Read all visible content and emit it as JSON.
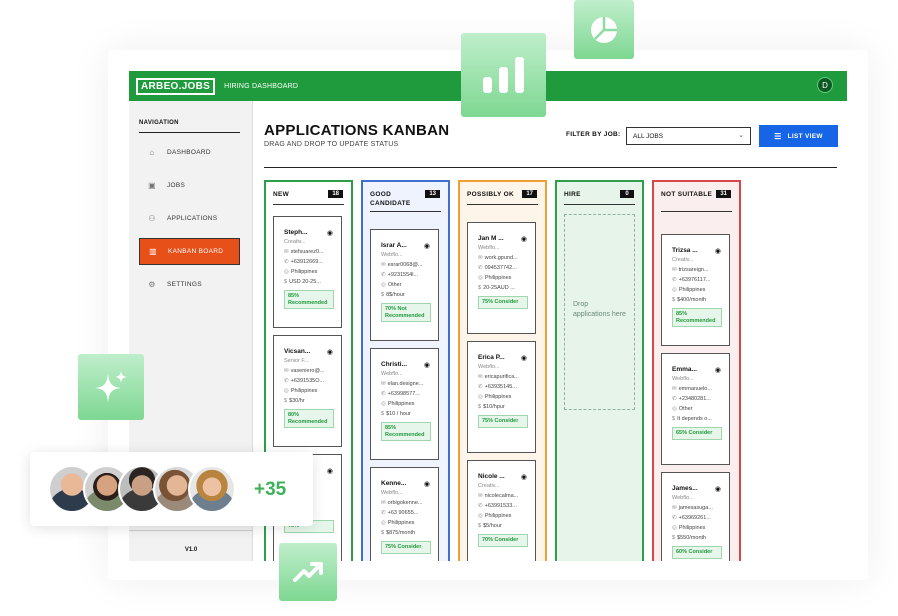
{
  "app": {
    "logo": "ARBEO.JOBS",
    "header": "HIRING DASHBOARD",
    "avatar": "D"
  },
  "sidebar": {
    "title": "NAVIGATION",
    "version": "V1.0",
    "items": [
      {
        "label": "DASHBOARD",
        "icon": "home-icon"
      },
      {
        "label": "JOBS",
        "icon": "briefcase-icon"
      },
      {
        "label": "APPLICATIONS",
        "icon": "users-icon"
      },
      {
        "label": "KANBAN BOARD",
        "icon": "kanban-icon",
        "active": true
      },
      {
        "label": "SETTINGS",
        "icon": "gear-icon"
      }
    ]
  },
  "main": {
    "title": "APPLICATIONS KANBAN",
    "subtitle": "DRAG AND DROP TO UPDATE STATUS",
    "filter_label": "FILTER BY JOB:",
    "filter_value": "ALL JOBS",
    "list_view": "LIST VIEW"
  },
  "columns": [
    {
      "name": "NEW",
      "count": "18",
      "color": "#2e9e4a",
      "bg": "#fff",
      "cards": [
        {
          "name": "Steph...",
          "role": "Creativ...",
          "email": "stefsuarez0...",
          "phone": "+63912669...",
          "loc": "Philippines",
          "rate": "USD 20-25...",
          "badge": "85% Recommended"
        },
        {
          "name": "Vicsan...",
          "role": "Senior F...",
          "email": "vasenierо@...",
          "phone": "+6391535О...",
          "loc": "Philippines",
          "rate": "$30/hr",
          "badge": "80% Recommended"
        },
        {
          "name": "",
          "role": "",
          "email": "...gro...",
          "phone": "...57...",
          "loc": "...nes",
          "rate": "...rs $...",
          "badge": "75%"
        }
      ]
    },
    {
      "name": "GOOD CANDIDATE",
      "count": "13",
      "color": "#3f6fd1",
      "bg": "#eef3fd",
      "cards": [
        {
          "name": "Israr A...",
          "role": "Webflo...",
          "email": "esrar0068@...",
          "phone": "+9231554l...",
          "loc": "Other",
          "rate": "8$/hour",
          "badge": "70% Not Recommended"
        },
        {
          "name": "Christi...",
          "role": "Webflo...",
          "email": "elan.designe...",
          "phone": "+63998577...",
          "loc": "Philippines",
          "rate": "$10 / hour",
          "badge": "85% Recommended"
        },
        {
          "name": "Kenne...",
          "role": "Webflo...",
          "email": "orbigokenne...",
          "phone": "+63 90655...",
          "loc": "Philippines",
          "rate": "$875/month",
          "badge": "75% Consider"
        }
      ]
    },
    {
      "name": "POSSIBLY OK",
      "count": "17",
      "color": "#f0a030",
      "bg": "#fdf5e9",
      "cards": [
        {
          "name": "Jan M ...",
          "role": "Webflo...",
          "email": "work.gpund...",
          "phone": "094537742...",
          "loc": "Philippines",
          "rate": "20-25AUD ...",
          "badge": "75% Consider"
        },
        {
          "name": "Erica P...",
          "role": "Webflo...",
          "email": "ericapurifica...",
          "phone": "+63935145...",
          "loc": "Philippines",
          "rate": "$10/hpur",
          "badge": "75% Consider"
        },
        {
          "name": "Nicole ...",
          "role": "Creativ...",
          "email": "nicolecalma...",
          "phone": "+63991533...",
          "loc": "Philippines",
          "rate": "$5/hour",
          "badge": "70% Consider"
        }
      ]
    },
    {
      "name": "HIRE",
      "count": "0",
      "color": "#2e9e4a",
      "bg": "#e6f4ea",
      "drop": "Drop applications here",
      "cards": []
    },
    {
      "name": "NOT SUITABLE",
      "count": "31",
      "color": "#d94848",
      "bg": "#fbeeee",
      "cards": [
        {
          "name": "Trizsa ...",
          "role": "Creativ...",
          "email": "trizsareign...",
          "phone": "+63976117...",
          "loc": "Philippines",
          "rate": "$400/month",
          "badge": "85% Recommended"
        },
        {
          "name": "Emma...",
          "role": "Webflo...",
          "email": "emmanuelo...",
          "phone": "+23480281...",
          "loc": "Other",
          "rate": "It depends o...",
          "badge": "65% Consider"
        },
        {
          "name": "James...",
          "role": "Webflo...",
          "email": "jamesasuga...",
          "phone": "+63969261...",
          "loc": "Philippines",
          "rate": "$550/month",
          "badge": "60% Consider"
        }
      ]
    }
  ],
  "overlay": {
    "more": "+35"
  }
}
